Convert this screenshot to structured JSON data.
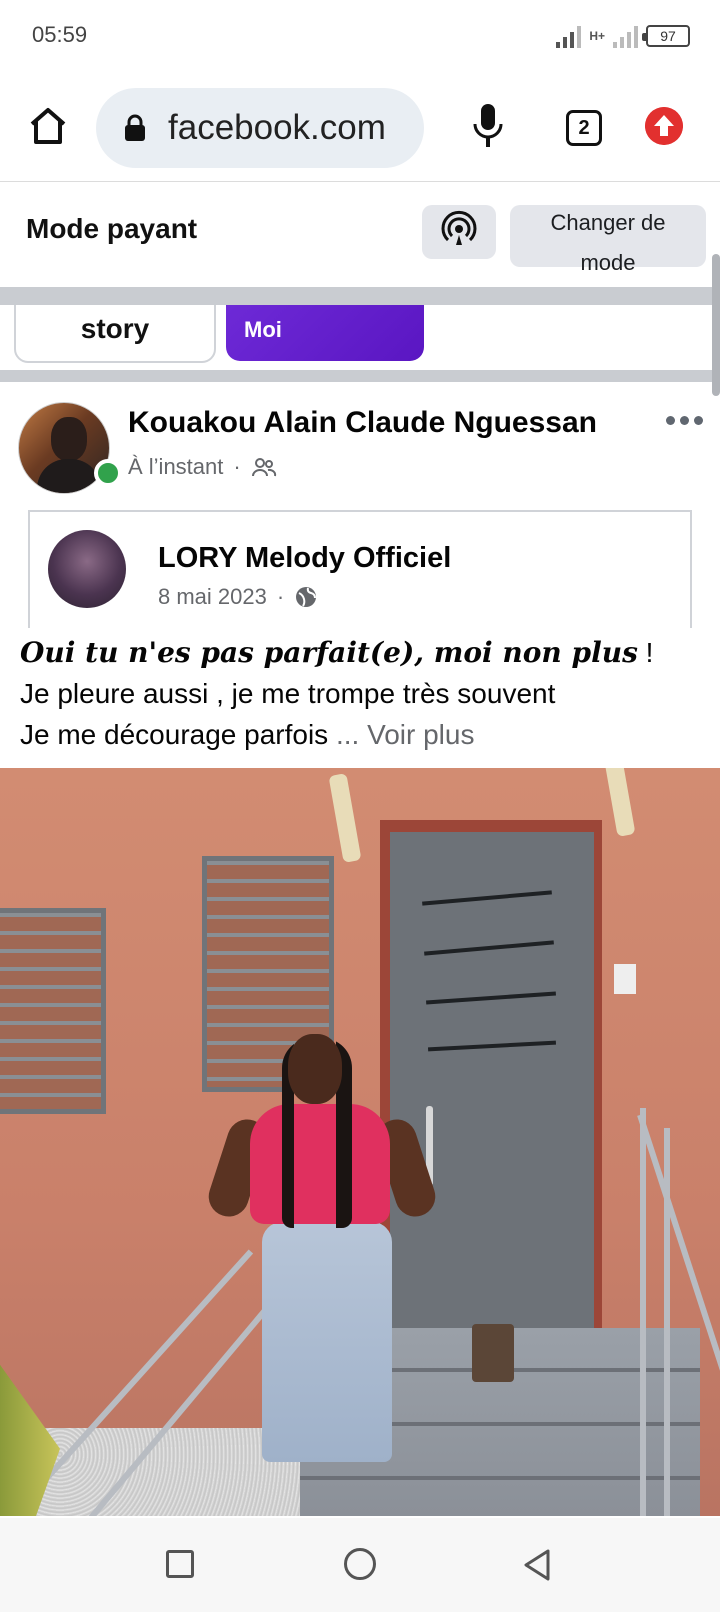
{
  "status_bar": {
    "time": "05:59",
    "network_type": "H+",
    "battery": "97"
  },
  "browser": {
    "url": "facebook.com",
    "tab_count": "2",
    "icons": [
      "home-icon",
      "lock-icon",
      "mic-icon",
      "tabs-icon",
      "update-icon"
    ]
  },
  "mode_banner": {
    "title": "Mode payant",
    "change_label": "Changer de mode",
    "hotspot_icon": "hotspot-icon"
  },
  "stories": {
    "create_label": "story",
    "second_label": "Moi"
  },
  "post": {
    "author": "Kouakou Alain Claude Nguessan",
    "time": "À l’instant",
    "audience_icon": "friends-icon",
    "shared": {
      "name": "LORY Melody Officiel",
      "date": "8 mai 2023",
      "audience_icon": "globe-icon"
    },
    "text": {
      "line1_fancy": "Oui tu n'es pas parfait(e), moi non plus",
      "line1_end": " !",
      "line2": "Je pleure aussi , je me trompe très souvent",
      "line3": "Je me décourage parfois",
      "see_more": "... Voir plus"
    }
  },
  "colors": {
    "online": "#31a24c",
    "purple_story": "#6f2bd8",
    "update_red": "#e2302f",
    "muted_text": "#65676b"
  }
}
